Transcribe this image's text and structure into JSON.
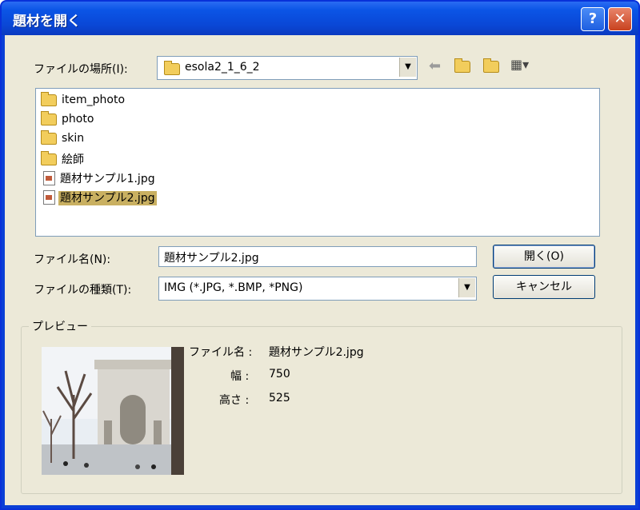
{
  "window": {
    "title": "題材を開く",
    "help_symbol": "?",
    "close_symbol": "✕"
  },
  "location": {
    "label": "ファイルの場所(I):",
    "value": "esola2_1_6_2",
    "toolbar": [
      "back-icon",
      "up-folder-icon",
      "new-folder-icon",
      "view-menu-icon"
    ]
  },
  "files": [
    {
      "name": "item_photo",
      "type": "folder"
    },
    {
      "name": "photo",
      "type": "folder"
    },
    {
      "name": "skin",
      "type": "folder"
    },
    {
      "name": "絵師",
      "type": "folder"
    },
    {
      "name": "題材サンプル1.jpg",
      "type": "file"
    },
    {
      "name": "題材サンプル2.jpg",
      "type": "file",
      "selected": true
    }
  ],
  "filename": {
    "label": "ファイル名(N):",
    "value": "題材サンプル2.jpg"
  },
  "filetype": {
    "label": "ファイルの種類(T):",
    "value": "IMG (*.JPG, *.BMP, *PNG)"
  },
  "buttons": {
    "open": "開く(O)",
    "cancel": "キャンセル"
  },
  "preview": {
    "group_label": "プレビュー",
    "name_label": "ファイル名 :",
    "name_value": "題材サンプル2.jpg",
    "width_label": "幅 :",
    "width_value": "750",
    "height_label": "高さ :",
    "height_value": "525"
  },
  "colors": {
    "titlebar": "#0a47d6",
    "dialog_bg": "#ece9d8",
    "selection": "#c9b061"
  }
}
